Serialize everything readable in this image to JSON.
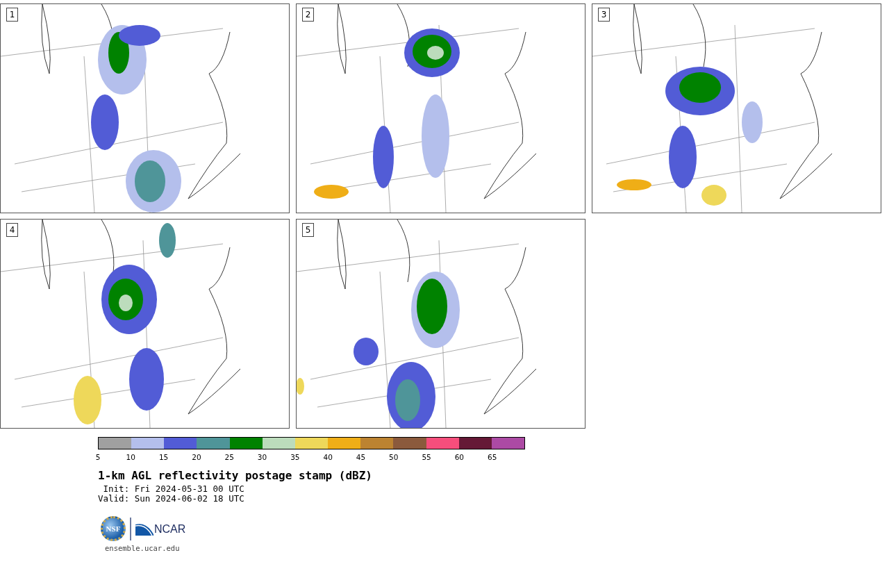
{
  "panels": [
    {
      "label": "1"
    },
    {
      "label": "2"
    },
    {
      "label": "3"
    },
    {
      "label": "4"
    },
    {
      "label": "5"
    }
  ],
  "colorbar": {
    "bins": [
      {
        "color": "#a0a0a0"
      },
      {
        "color": "#b4bfec"
      },
      {
        "color": "#525cd6"
      },
      {
        "color": "#4f9599"
      },
      {
        "color": "#008200"
      },
      {
        "color": "#bcdcbc"
      },
      {
        "color": "#eed85a"
      },
      {
        "color": "#efae17"
      },
      {
        "color": "#bc8331"
      },
      {
        "color": "#8b5a3c"
      },
      {
        "color": "#f64e7c"
      },
      {
        "color": "#651936"
      },
      {
        "color": "#ac4aa4"
      }
    ],
    "ticks": [
      "5",
      "10",
      "15",
      "20",
      "25",
      "30",
      "35",
      "40",
      "45",
      "50",
      "55",
      "60",
      "65"
    ]
  },
  "title": "1-km AGL reflectivity postage stamp (dBZ)",
  "init": " Init: Fri 2024-05-31 00 UTC",
  "valid": "Valid: Sun 2024-06-02 18 UTC",
  "logos": {
    "nsf": "NSF",
    "ncar": "NCAR"
  },
  "url": "ensemble.ucar.edu"
}
